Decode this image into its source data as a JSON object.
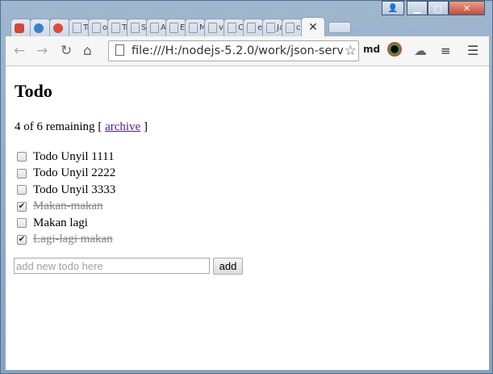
{
  "browser": {
    "tabs": [
      {
        "label": "",
        "icon": "gmail-icon",
        "color": "#d44638"
      },
      {
        "label": "",
        "icon": "globe-icon",
        "color": "#3f7fc4"
      },
      {
        "label": "",
        "icon": "google-plus-icon",
        "color": "#dd4b39"
      },
      {
        "label": "Tr",
        "icon": "page-icon",
        "color": "#999999"
      },
      {
        "label": "op",
        "icon": "page-icon",
        "color": "#999999"
      },
      {
        "label": "Tr",
        "icon": "page-icon",
        "color": "#999999"
      },
      {
        "label": "Sp",
        "icon": "page-icon",
        "color": "#999999"
      },
      {
        "label": "Ap",
        "icon": "page-icon",
        "color": "#999999"
      },
      {
        "label": "Ev",
        "icon": "page-icon",
        "color": "#999999"
      },
      {
        "label": "M",
        "icon": "page-icon",
        "color": "#999999"
      },
      {
        "label": "vu",
        "icon": "page-icon",
        "color": "#999999"
      },
      {
        "label": "Cr",
        "icon": "page-icon",
        "color": "#999999"
      },
      {
        "label": "ex",
        "icon": "page-icon",
        "color": "#999999"
      },
      {
        "label": "Ja",
        "icon": "page-icon",
        "color": "#999999"
      },
      {
        "label": "cc",
        "icon": "page-icon",
        "color": "#999999"
      }
    ],
    "active_tab_close": "✕",
    "address": "file:///H:/nodejs-5.2.0/work/json-serv",
    "extension_label": "md"
  },
  "page": {
    "title": "Todo",
    "remaining_text": "4 of 6 remaining",
    "bracket_open": "[",
    "archive_label": "archive",
    "bracket_close": "]",
    "todos": [
      {
        "text": "Todo Unyil 1111",
        "done": false
      },
      {
        "text": "Todo Unyil 2222",
        "done": false
      },
      {
        "text": "Todo Unyil 3333",
        "done": false
      },
      {
        "text": "Makan-makan",
        "done": true
      },
      {
        "text": "Makan lagi",
        "done": false
      },
      {
        "text": "Lagi-lagi makan",
        "done": true
      }
    ],
    "new_todo_placeholder": "add new todo here",
    "add_label": "add"
  }
}
